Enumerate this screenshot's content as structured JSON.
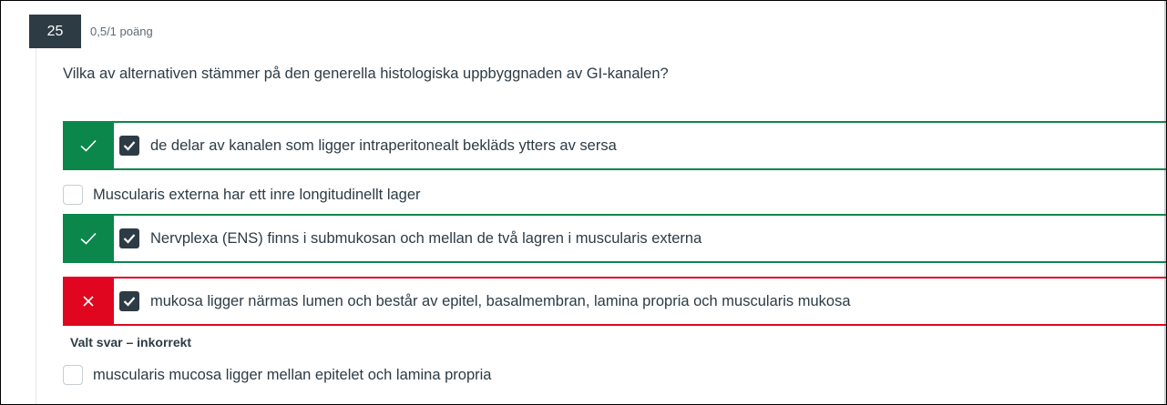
{
  "question": {
    "number": "25",
    "points": "0,5/1 poäng",
    "text": "Vilka av alternativen stämmer på den generella histologiska uppbyggnaden av GI-kanalen?"
  },
  "answers": [
    {
      "label": "de delar av kanalen som ligger intraperitonealt bekläds ytters av sersa",
      "selected": true,
      "status": "correct",
      "status_icon": "check-icon"
    },
    {
      "label": "Muscularis externa har ett inre longitudinellt lager",
      "selected": false,
      "status": "none"
    },
    {
      "label": "Nervplexa (ENS) finns i submukosan och mellan de två lagren i muscularis externa",
      "selected": true,
      "status": "correct",
      "status_icon": "check-icon"
    },
    {
      "label": "mukosa ligger närmas lumen och består av epitel, basalmembran, lamina propria och muscularis mukosa",
      "selected": true,
      "status": "incorrect",
      "status_icon": "close-icon",
      "feedback": "Valt svar – inkorrekt"
    },
    {
      "label": "muscularis mucosa ligger mellan epitelet och lamina propria",
      "selected": false,
      "status": "none"
    }
  ],
  "colors": {
    "correct": "#0b874b",
    "incorrect": "#e0061f",
    "badge": "#2d3b45",
    "text": "#2d3b45"
  }
}
